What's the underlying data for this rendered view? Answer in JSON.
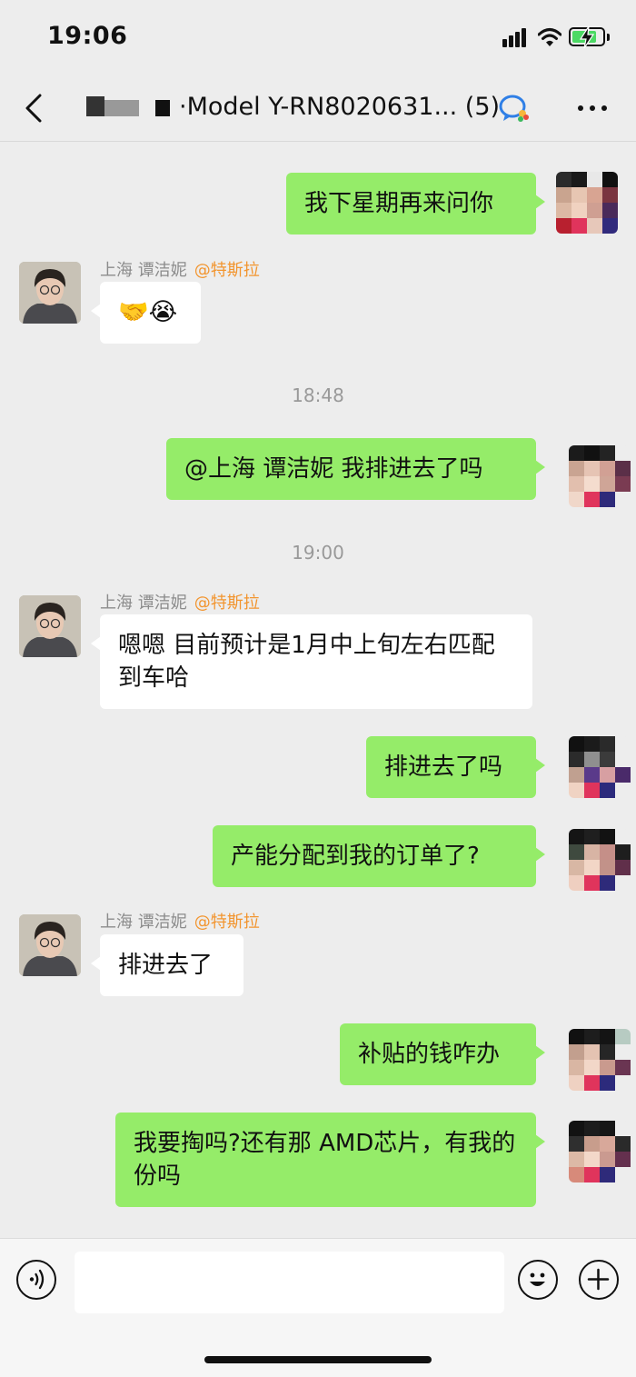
{
  "status_bar": {
    "time": "19:06",
    "battery_color": "#4cd964"
  },
  "nav": {
    "back_icon": "chevron-left-icon",
    "title": "·Model Y-RN8020631... (5)",
    "enterprise_icon": "wecom-icon",
    "more_icon": "more-dots-icon"
  },
  "contact": {
    "name": "上海 谭洁妮",
    "org_tag": "@特斯拉"
  },
  "messages": [
    {
      "from": "self",
      "text": "我下星期再来问你"
    },
    {
      "from": "other",
      "text": "🤝😭"
    },
    {
      "from": "time",
      "text": "18:48"
    },
    {
      "from": "self",
      "text": "@上海 谭洁妮 我排进去了吗"
    },
    {
      "from": "time",
      "text": "19:00"
    },
    {
      "from": "other",
      "text": "嗯嗯 目前预计是1月中上旬左右匹配到车哈"
    },
    {
      "from": "self",
      "text": "排进去了吗"
    },
    {
      "from": "self",
      "text": "产能分配到我的订单了?"
    },
    {
      "from": "other",
      "text": "排进去了"
    },
    {
      "from": "self",
      "text": "补贴的钱咋办"
    },
    {
      "from": "self",
      "text": "我要掏吗?还有那 AMD芯片，有我的份吗"
    }
  ],
  "input_bar": {
    "voice_icon": "voice-icon",
    "input_value": "",
    "emoji_icon": "emoji-icon",
    "plus_icon": "plus-icon"
  },
  "colors": {
    "self_bubble": "#95ec69",
    "other_bubble": "#ffffff",
    "org_tag": "#f2952f",
    "background": "#ededed"
  }
}
